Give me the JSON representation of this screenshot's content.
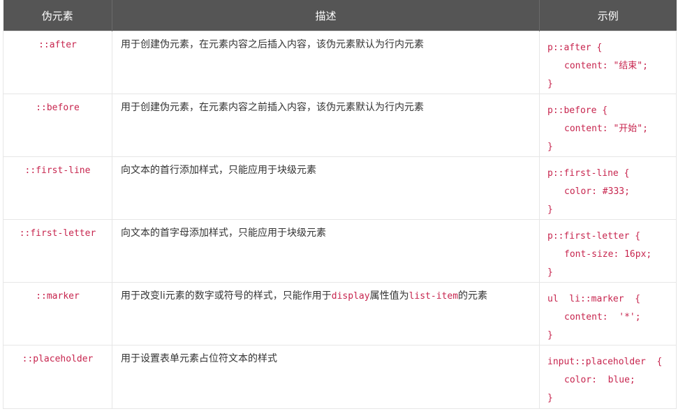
{
  "headers": {
    "pseudo": "伪元素",
    "description": "描述",
    "example": "示例"
  },
  "rows": [
    {
      "name": "::after",
      "description": "用于创建伪元素，在元素内容之后插入内容，该伪元素默认为行内元素",
      "example": [
        "p::after {",
        "content: \"结束\";",
        "}"
      ]
    },
    {
      "name": "::before",
      "description": "用于创建伪元素，在元素内容之前插入内容，该伪元素默认为行内元素",
      "example": [
        "p::before {",
        "content: \"开始\";",
        "}"
      ]
    },
    {
      "name": "::first-line",
      "description": "向文本的首行添加样式，只能应用于块级元素",
      "example": [
        "p::first-line {",
        "color: #333;",
        "}"
      ]
    },
    {
      "name": "::first-letter",
      "description": "向文本的首字母添加样式，只能应用于块级元素",
      "example": [
        "p::first-letter {",
        "font-size: 16px;",
        "}"
      ]
    },
    {
      "name": "::marker",
      "description_parts": {
        "before": "用于改变li元素的数字或符号的样式，只能作用于",
        "code1": "display",
        "middle": "属性值为",
        "code2": "list-item",
        "after": "的元素"
      },
      "example": [
        "ul  li::marker  {",
        "content:  '*';",
        "}"
      ]
    },
    {
      "name": "::placeholder",
      "description": "用于设置表单元素占位符文本的样式",
      "example": [
        "input::placeholder  {",
        "color:  blue;",
        "}"
      ]
    }
  ]
}
